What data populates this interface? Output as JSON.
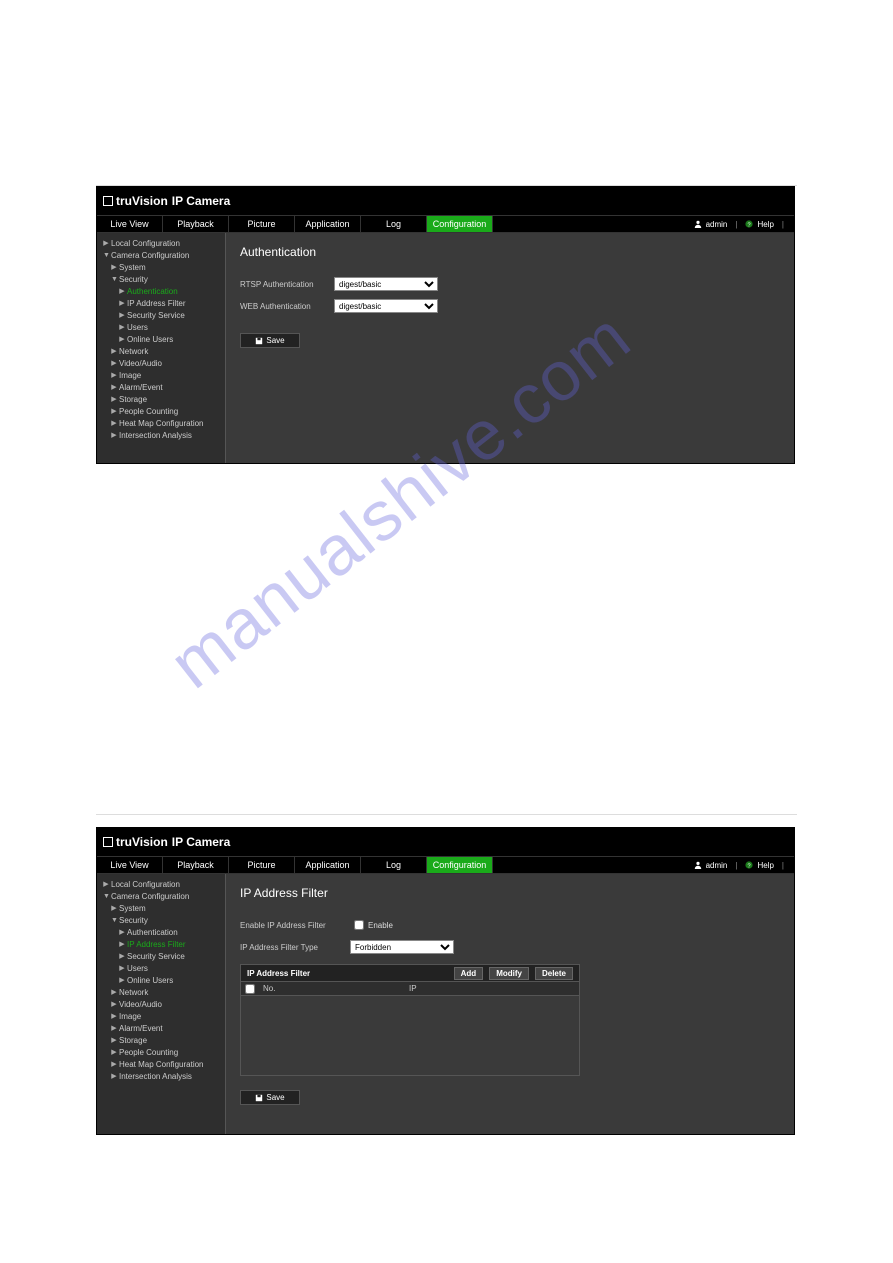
{
  "brand": {
    "name": "truVision",
    "product": "IP Camera"
  },
  "nav": {
    "tabs": [
      "Live View",
      "Playback",
      "Picture",
      "Application",
      "Log",
      "Configuration"
    ],
    "active_index": 5,
    "user": "admin",
    "help": "Help"
  },
  "sidebar": {
    "local_cfg": "Local Configuration",
    "camera_cfg": "Camera Configuration",
    "system": "System",
    "security": "Security",
    "authentication": "Authentication",
    "ip_filter": "IP Address Filter",
    "sec_service": "Security Service",
    "users": "Users",
    "online_users": "Online Users",
    "network": "Network",
    "video_audio": "Video/Audio",
    "image": "Image",
    "alarm_event": "Alarm/Event",
    "storage": "Storage",
    "people_counting": "People Counting",
    "heat_map": "Heat Map Configuration",
    "intersection": "Intersection Analysis"
  },
  "screen1": {
    "title": "Authentication",
    "rtsp_label": "RTSP Authentication",
    "web_label": "WEB Authentication",
    "option_value": "digest/basic",
    "save": "Save"
  },
  "screen2": {
    "title": "IP Address Filter",
    "enable_label": "Enable IP Address Filter",
    "enable_cb": "Enable",
    "type_label": "IP Address Filter Type",
    "type_value": "Forbidden",
    "table_title": "IP Address Filter",
    "btn_add": "Add",
    "btn_modify": "Modify",
    "btn_delete": "Delete",
    "col_no": "No.",
    "col_ip": "IP",
    "save": "Save"
  },
  "watermark": "manualshive.com"
}
